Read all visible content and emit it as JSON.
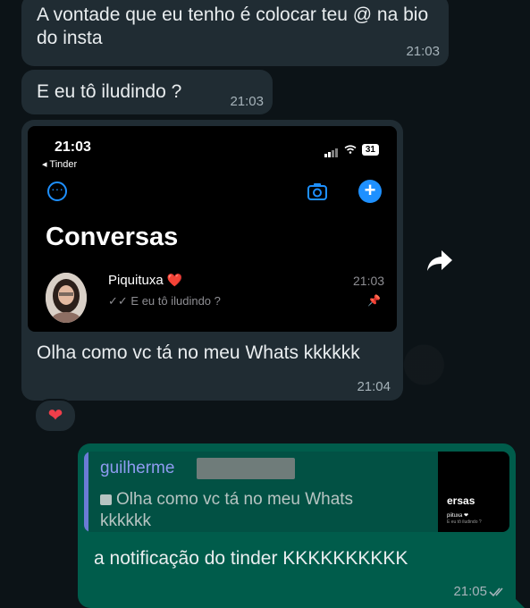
{
  "messages": {
    "first": {
      "text": "A vontade que eu tenho é colocar teu @ na bio do insta",
      "time": "21:03"
    },
    "second": {
      "text": "E eu tô iludindo ?",
      "time": "21:03"
    },
    "image_message": {
      "caption": "Olha como vc tá no meu Whats kkkkkk",
      "time": "21:04",
      "reaction": "❤️"
    },
    "reply": {
      "quoted_name": "guilherme",
      "quoted_text": "Olha como vc tá no meu Whats kkkkkk",
      "thumb_title": "ersas",
      "thumb_name": "piituxa ❤",
      "thumb_preview": "E eu tô iludindo ?",
      "text": "a notificação do tinder KKKKKKKKKK",
      "time": "21:05"
    }
  },
  "screenshot": {
    "status_time": "21:03",
    "back_label": "◂ Tinder",
    "battery": "31",
    "title": "Conversas",
    "contact_name": "Piquituxa",
    "contact_heart": "❤️",
    "contact_time": "21:03",
    "contact_preview": "E eu tô iludindo ?",
    "accent_color": "#1e90ff"
  },
  "colors": {
    "background": "#0c1317",
    "incoming_bubble": "#202c33",
    "outgoing_bubble": "#005c4b",
    "quote_name": "#8e9bf0"
  },
  "icons": [
    "more-circle-icon",
    "camera-icon",
    "plus-icon",
    "forward-icon",
    "pin-icon",
    "double-check-icon",
    "heart-reaction-icon"
  ]
}
